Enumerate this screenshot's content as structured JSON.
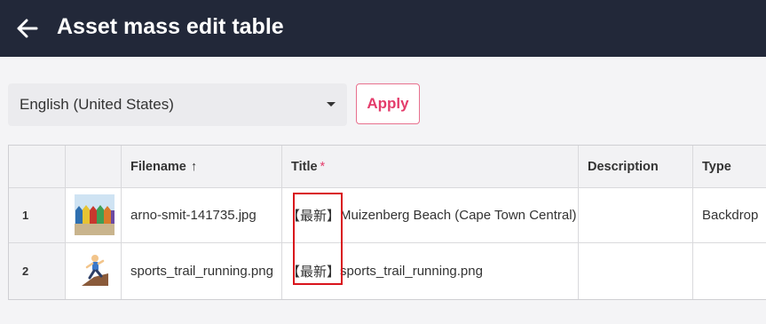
{
  "header": {
    "title": "Asset mass edit table",
    "back_icon": "arrow-left-icon"
  },
  "controls": {
    "locale_value": "English (United States)",
    "apply_label": "Apply"
  },
  "table": {
    "columns": {
      "filename": "Filename",
      "filename_sort": "↑",
      "title": "Title",
      "title_required": "*",
      "description": "Description",
      "type": "Type"
    },
    "rows": [
      {
        "index": "1",
        "thumbnail": "beach-huts-image",
        "filename": "arno-smit-141735.jpg",
        "title_tag": "【最新】",
        "title_text": "Muizenberg Beach (Cape Town Central)",
        "description": "",
        "type": "Backdrop"
      },
      {
        "index": "2",
        "thumbnail": "runner-emoji-image",
        "filename": "sports_trail_running.png",
        "title_tag": "【最新】",
        "title_text": "sports_trail_running.png",
        "description": "",
        "type": ""
      }
    ]
  },
  "colors": {
    "topbar": "#222839",
    "accent": "#e43c6b",
    "highlight": "#d9141c"
  }
}
